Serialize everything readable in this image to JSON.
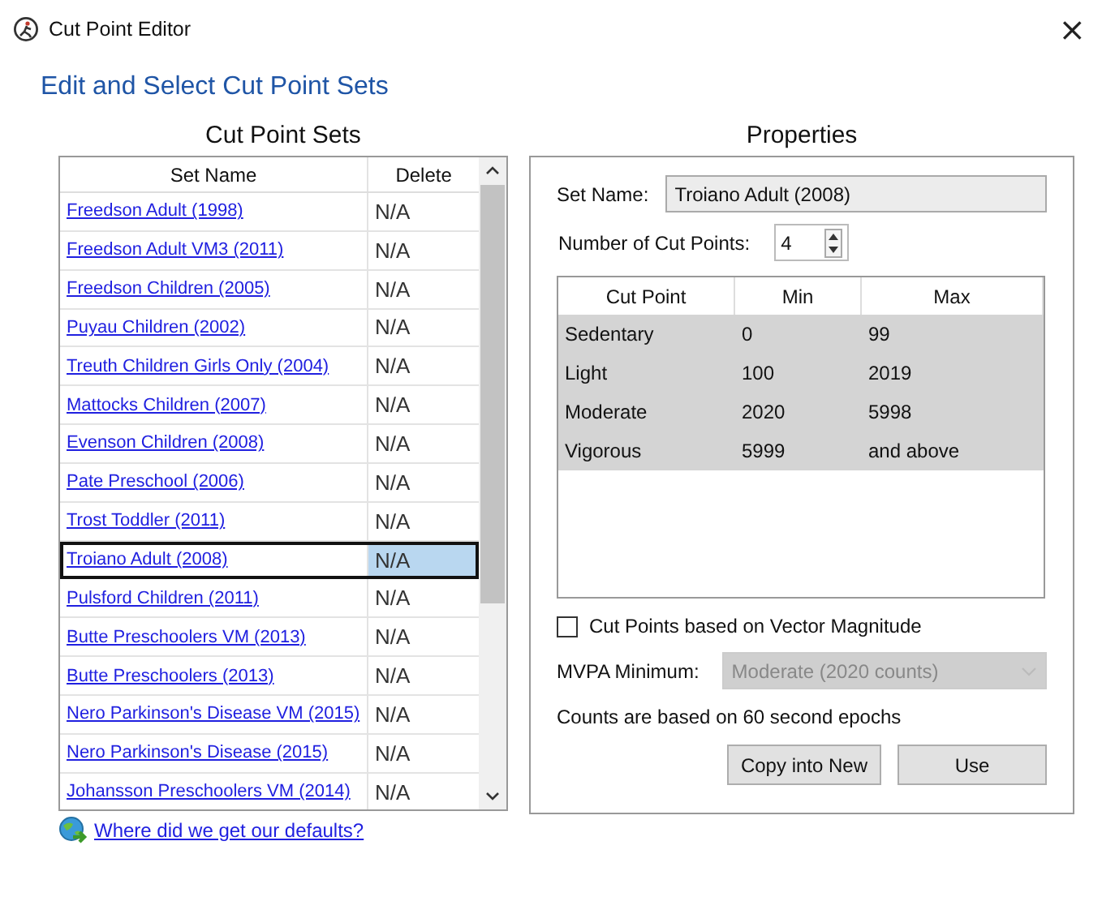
{
  "window": {
    "title": "Cut Point Editor",
    "close": "×"
  },
  "heading": "Edit and Select Cut Point Sets",
  "set_list": {
    "title": "Cut Point Sets",
    "columns": [
      "Set Name",
      "Delete"
    ],
    "rows": [
      {
        "name": "Freedson Adult (1998)",
        "delete": "N/A",
        "selected": false
      },
      {
        "name": "Freedson Adult VM3 (2011)",
        "delete": "N/A",
        "selected": false
      },
      {
        "name": "Freedson Children (2005)",
        "delete": "N/A",
        "selected": false
      },
      {
        "name": "Puyau Children (2002)",
        "delete": "N/A",
        "selected": false
      },
      {
        "name": "Treuth Children Girls Only (2004)",
        "delete": "N/A",
        "selected": false
      },
      {
        "name": "Mattocks Children (2007)",
        "delete": "N/A",
        "selected": false
      },
      {
        "name": "Evenson Children (2008)",
        "delete": "N/A",
        "selected": false
      },
      {
        "name": "Pate Preschool (2006)",
        "delete": "N/A",
        "selected": false
      },
      {
        "name": "Trost Toddler (2011)",
        "delete": "N/A",
        "selected": false
      },
      {
        "name": "Troiano Adult (2008)",
        "delete": "N/A",
        "selected": true
      },
      {
        "name": "Pulsford Children (2011)",
        "delete": "N/A",
        "selected": false
      },
      {
        "name": "Butte Preschoolers VM (2013)",
        "delete": "N/A",
        "selected": false
      },
      {
        "name": "Butte Preschoolers (2013)",
        "delete": "N/A",
        "selected": false
      },
      {
        "name": "Nero Parkinson's Disease VM (2015)",
        "delete": "N/A",
        "selected": false
      },
      {
        "name": "Nero Parkinson's Disease (2015)",
        "delete": "N/A",
        "selected": false
      },
      {
        "name": "Johansson Preschoolers VM (2014)",
        "delete": "N/A",
        "selected": false
      }
    ]
  },
  "defaults_link": "Where did we get our defaults?",
  "properties": {
    "title": "Properties",
    "set_name_label": "Set Name:",
    "set_name": "Troiano Adult (2008)",
    "count_label": "Number of Cut Points:",
    "count": "4",
    "table": {
      "columns": [
        "Cut Point",
        "Min",
        "Max"
      ],
      "rows": [
        {
          "cut_point": "Sedentary",
          "min": "0",
          "max": "99"
        },
        {
          "cut_point": "Light",
          "min": "100",
          "max": "2019"
        },
        {
          "cut_point": "Moderate",
          "min": "2020",
          "max": "5998"
        },
        {
          "cut_point": "Vigorous",
          "min": "5999",
          "max": "and above"
        }
      ]
    },
    "vector_magnitude": {
      "label": "Cut Points based on Vector Magnitude",
      "checked": false
    },
    "mvpa": {
      "label": "MVPA Minimum:",
      "value": "Moderate (2020 counts)",
      "disabled": true
    },
    "note": "Counts are based on 60 second epochs",
    "buttons": [
      "Copy into New",
      "Use"
    ]
  }
}
